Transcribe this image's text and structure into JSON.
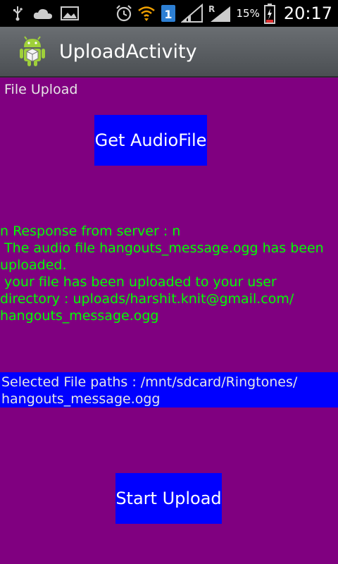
{
  "status_bar": {
    "battery_percent": "15%",
    "time": "20:17",
    "sim_badge": "1",
    "roaming_badge": "R"
  },
  "title_bar": {
    "title": "UploadActivity"
  },
  "main": {
    "page_label": "File Upload",
    "get_audio_button": "Get AudioFile",
    "response_text": "n Response from server : n\n The audio file hangouts_message.ogg has been uploaded.\n your file has been uploaded to your user directory : uploads/harshit.knit@gmail.com/\nhangouts_message.ogg",
    "selected_paths": "Selected File paths : /mnt/sdcard/Ringtones/\nhangouts_message.ogg",
    "start_upload_button": "Start Upload"
  },
  "colors": {
    "background": "#800080",
    "button": "#0000ff",
    "response_text": "#00ff00"
  }
}
